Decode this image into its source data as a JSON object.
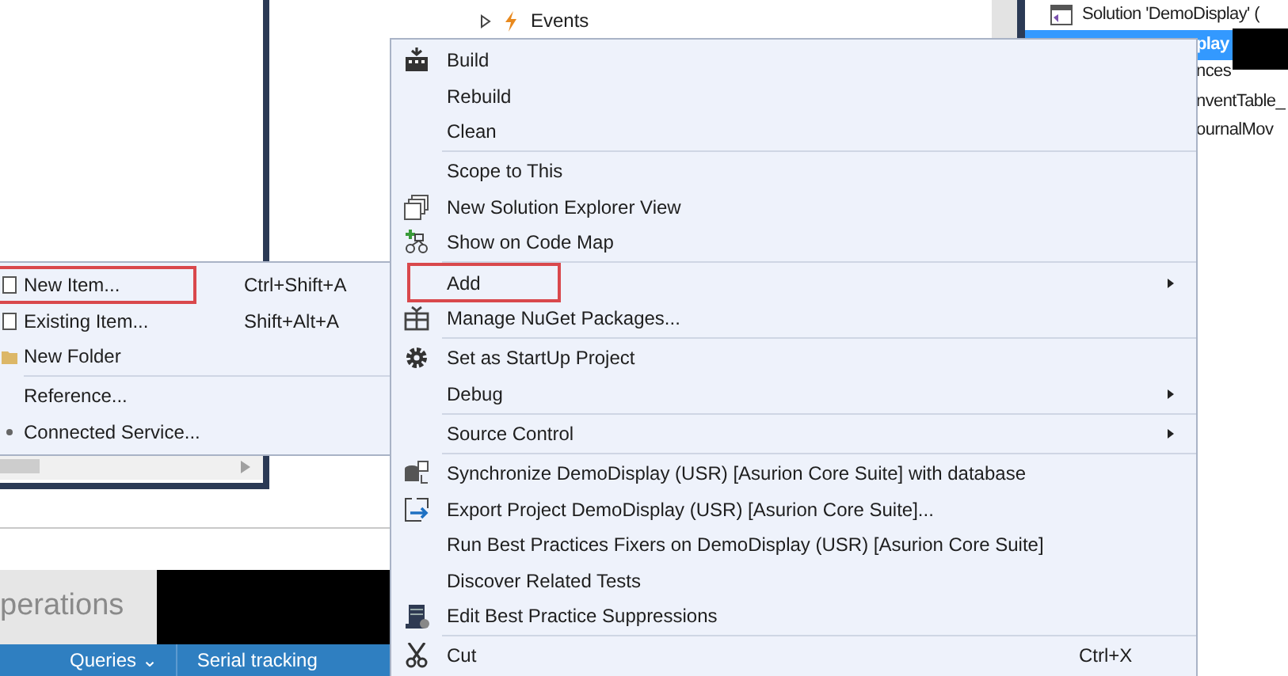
{
  "code_tree": {
    "item": {
      "label": "Events",
      "expanded": false
    }
  },
  "solution_explorer": {
    "items": [
      {
        "label": "Solution 'DemoDisplay' (",
        "selected": false
      },
      {
        "label": "play",
        "selected": true
      },
      {
        "label": "nces",
        "selected": false
      },
      {
        "label": "nventTable_",
        "selected": false
      },
      {
        "label": "ournalMov",
        "selected": false
      }
    ]
  },
  "add_submenu": {
    "groups": [
      [
        {
          "label": "New Item...",
          "shortcut": "Ctrl+Shift+A",
          "highlighted": true
        },
        {
          "label": "Existing Item...",
          "shortcut": "Shift+Alt+A",
          "highlighted": false
        },
        {
          "label": "New Folder",
          "highlighted": false
        }
      ],
      [
        {
          "label": "Reference...",
          "highlighted": false
        },
        {
          "label": "Connected Service...",
          "highlighted": false
        }
      ]
    ]
  },
  "bottom_panel": {
    "tab": {
      "label": "perations"
    },
    "toolbar": [
      {
        "label": "Queries ⌄"
      },
      {
        "label": "Serial tracking"
      }
    ]
  },
  "context_menu": {
    "groups": [
      [
        {
          "label": "Build",
          "submenu": false,
          "highlighted": false
        },
        {
          "label": "Rebuild",
          "submenu": false,
          "highlighted": false
        },
        {
          "label": "Clean",
          "submenu": false,
          "highlighted": false
        }
      ],
      [
        {
          "label": "Scope to This",
          "submenu": false,
          "highlighted": false
        },
        {
          "label": "New Solution Explorer View",
          "submenu": false,
          "highlighted": false
        },
        {
          "label": "Show on Code Map",
          "submenu": false,
          "highlighted": false
        }
      ],
      [
        {
          "label": "Add",
          "submenu": true,
          "highlighted": true
        },
        {
          "label": "Manage NuGet Packages...",
          "submenu": false,
          "highlighted": false
        }
      ],
      [
        {
          "label": "Set as StartUp Project",
          "submenu": false,
          "highlighted": false
        },
        {
          "label": "Debug",
          "submenu": true,
          "highlighted": false
        }
      ],
      [
        {
          "label": "Source Control",
          "submenu": true,
          "highlighted": false
        }
      ],
      [
        {
          "label": "Synchronize DemoDisplay (USR) [Asurion Core Suite] with database",
          "submenu": false,
          "highlighted": false
        },
        {
          "label": "Export Project DemoDisplay (USR) [Asurion Core Suite]...",
          "submenu": false,
          "highlighted": false
        },
        {
          "label": "Run Best Practices Fixers on DemoDisplay (USR) [Asurion Core Suite]",
          "submenu": false,
          "highlighted": false
        },
        {
          "label": "Discover Related Tests",
          "submenu": false,
          "highlighted": false
        },
        {
          "label": "Edit Best Practice Suppressions",
          "submenu": false,
          "highlighted": false
        }
      ],
      [
        {
          "label": "Cut",
          "shortcut": "Ctrl+X",
          "submenu": false,
          "highlighted": false
        }
      ]
    ]
  }
}
